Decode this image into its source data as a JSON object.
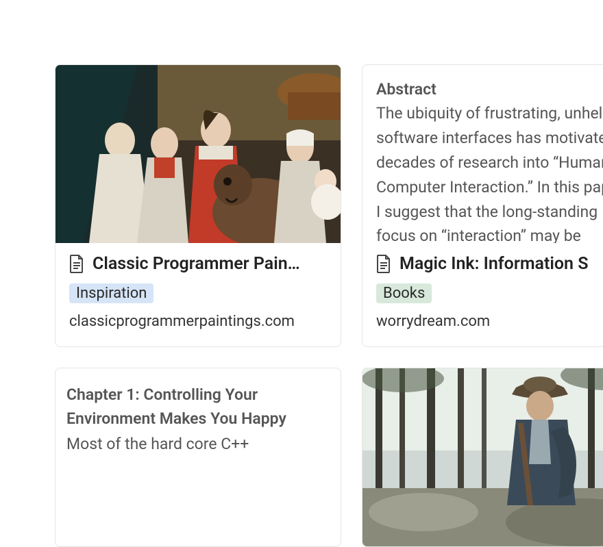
{
  "cards": [
    {
      "title": "Classic Programmer Pain…",
      "tag": {
        "label": "Inspiration",
        "kind": "inspiration"
      },
      "domain": "classicprogrammerpaintings.com",
      "preview": {
        "type": "image",
        "name": "painting-image"
      }
    },
    {
      "title": "Magic Ink: Information S",
      "tag": {
        "label": "Books",
        "kind": "books"
      },
      "domain": "worrydream.com",
      "preview": {
        "type": "text",
        "heading": "Abstract",
        "body": "The ubiquity of frustrating, unhelpful software interfaces has motivated decades of research into “Human-Computer Interaction.” In this paper, I suggest that the long-standing focus on “interaction” may be"
      }
    },
    {
      "preview": {
        "type": "text",
        "heading": "Chapter 1: Controlling Your Environment Makes You Happy",
        "body": "Most of the hard core C++"
      }
    },
    {
      "preview": {
        "type": "image",
        "name": "outdoor-image"
      }
    }
  ]
}
